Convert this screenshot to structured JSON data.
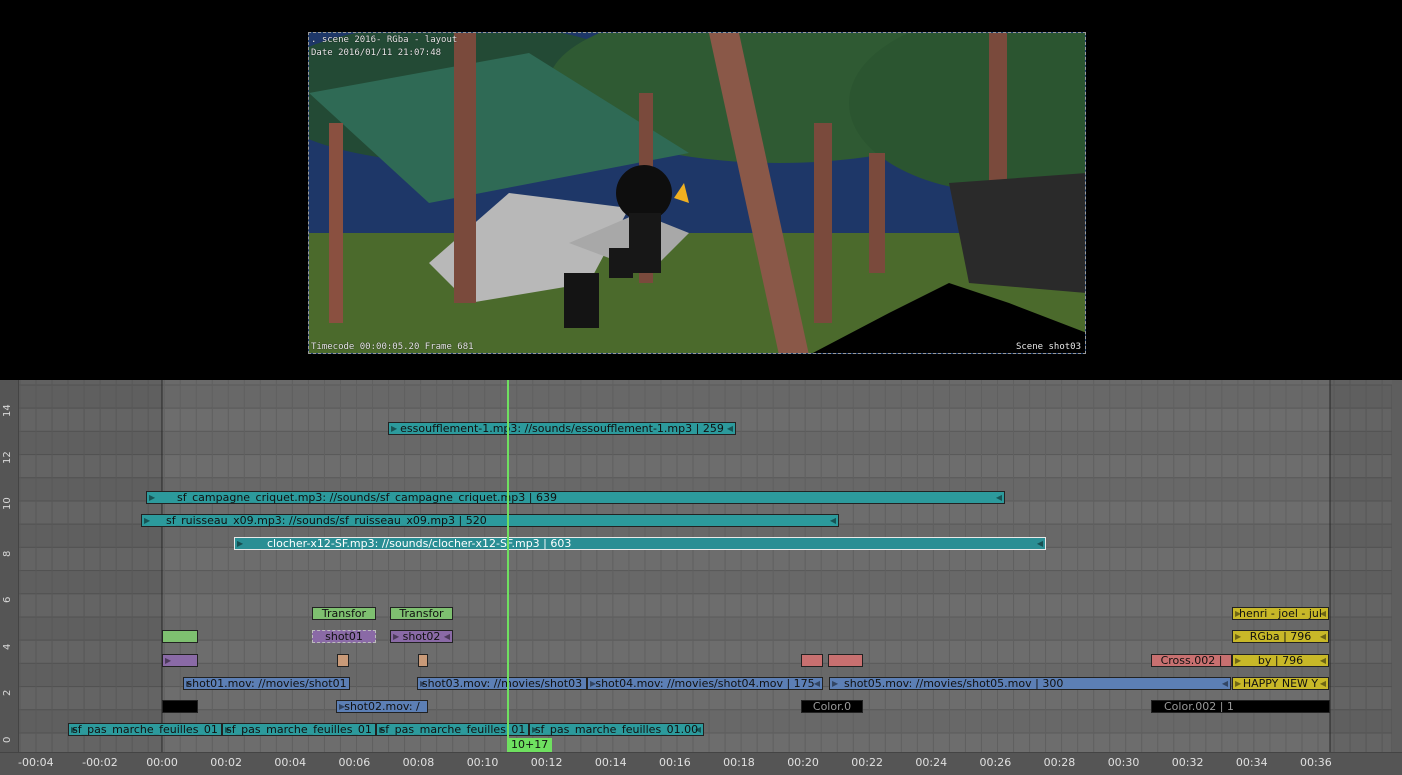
{
  "preview": {
    "stamp_top": ". scene 2016- RGba - layout",
    "stamp_date": "Date 2016/01/11 21:07:48",
    "stamp_timecode": "Timecode 00:00:05.20   Frame 681",
    "stamp_scene": "Scene shot03"
  },
  "ruler_vertical": [
    "0",
    "2",
    "4",
    "6",
    "8",
    "10",
    "12",
    "14"
  ],
  "ruler_horizontal": [
    "-00:04",
    "-00:02",
    "00:00",
    "00:02",
    "00:04",
    "00:06",
    "00:08",
    "00:10",
    "00:12",
    "00:14",
    "00:16",
    "00:18",
    "00:20",
    "00:22",
    "00:24",
    "00:26",
    "00:28",
    "00:30",
    "00:32",
    "00:34",
    "00:36"
  ],
  "playhead_label": "10+17",
  "strips": {
    "essoufflement": "essoufflement-1.mp3: //sounds/essoufflement-1.mp3 | 259",
    "campagne": "sf_campagne_criquet.mp3: //sounds/sf_campagne_criquet.mp3 | 639",
    "ruisseau": "sf_ruisseau_x09.mp3: //sounds/sf_ruisseau_x09.mp3 | 520",
    "clocher": "clocher-x12-SF.mp3: //sounds/clocher-x12-SF.mp3 | 603",
    "transfor1": "Transfor",
    "transfor2": "Transfor",
    "shot01_meta": "shot01",
    "shot02_meta": "shot02",
    "henri": "henri - joel - jul",
    "rgba": "RGba | 796",
    "cross": "Cross.002 |",
    "by": "by | 796",
    "shot01_mov": "shot01.mov: //movies/shot01",
    "shot03_mov": "shot03.mov: //movies/shot03",
    "shot04_mov": "shot04.mov: //movies/shot04.mov | 175",
    "shot05_mov": "shot05.mov: //movies/shot05.mov | 300",
    "happy": "HAPPY NEW Y",
    "shot02_mov": "shot02.mov: /",
    "color0": "Color.0",
    "color002": "Color.002 | 1",
    "pas1": "sf_pas_marche_feuilles_01",
    "pas2": "sf_pas_marche_feuilles_01",
    "pas3": "sf_pas_marche_feuilles_01",
    "pas4": "sf_pas_marche_feuilles_01.00"
  },
  "colors": {
    "sound": "#2c9a9c",
    "movie": "#5c7fb5",
    "effect": "#7ec070",
    "meta": "#8a6aa6",
    "text": "#c8b828",
    "cross": "#c87070",
    "playhead": "#6fe060"
  }
}
